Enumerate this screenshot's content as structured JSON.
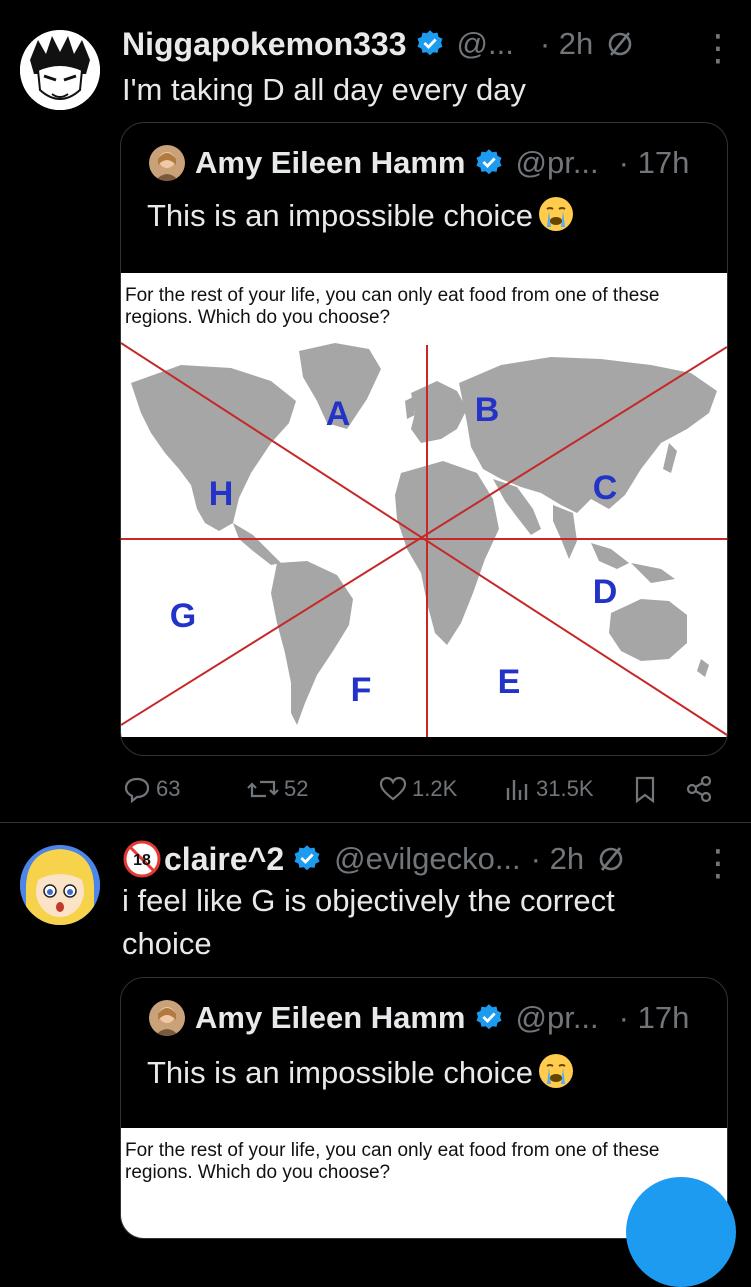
{
  "posts": [
    {
      "name": "Niggapokemon333",
      "handle": "@...",
      "time": "· 2h",
      "text": "I'm taking D all day every day",
      "quote": {
        "name": "Amy Eileen Hamm",
        "handle": "@pr...",
        "time": "· 17h",
        "text": "This is an impossible choice",
        "caption": "For the rest of your life, you can only eat food from one of these regions. Which do you choose?",
        "regions": [
          "A",
          "B",
          "C",
          "D",
          "E",
          "F",
          "G",
          "H"
        ]
      },
      "stats": {
        "replies": "63",
        "reposts": "52",
        "likes": "1.2K",
        "views": "31.5K"
      }
    },
    {
      "name": "claire^2",
      "handle": "@evilgecko...",
      "time": "· 2h",
      "text": "i feel like G is objectively the correct choice",
      "quote": {
        "name": "Amy Eileen Hamm",
        "handle": "@pr...",
        "time": "· 17h",
        "text": "This is an impossible choice",
        "caption": "For the rest of your life, you can only eat food from one of these regions. Which do you choose?"
      }
    }
  ],
  "colors": {
    "verified": "#1d9bf0",
    "muted": "#71767b",
    "map_line": "#c62828",
    "map_letter": "#2333c8",
    "land": "#a6a6a6"
  }
}
